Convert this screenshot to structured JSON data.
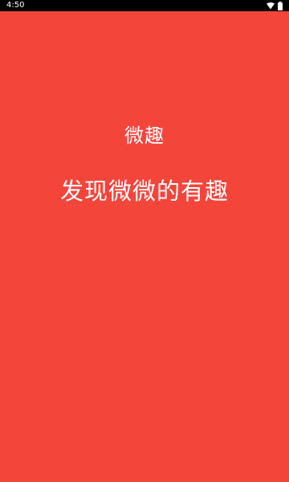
{
  "status_bar": {
    "time": "4:50",
    "icons": [
      "wifi-icon",
      "battery-icon"
    ]
  },
  "splash": {
    "app_name": "微趣",
    "slogan": "发现微微的有趣"
  },
  "colors": {
    "background": "#f4453b",
    "text": "#ffffff",
    "status_bar": "#000000"
  }
}
